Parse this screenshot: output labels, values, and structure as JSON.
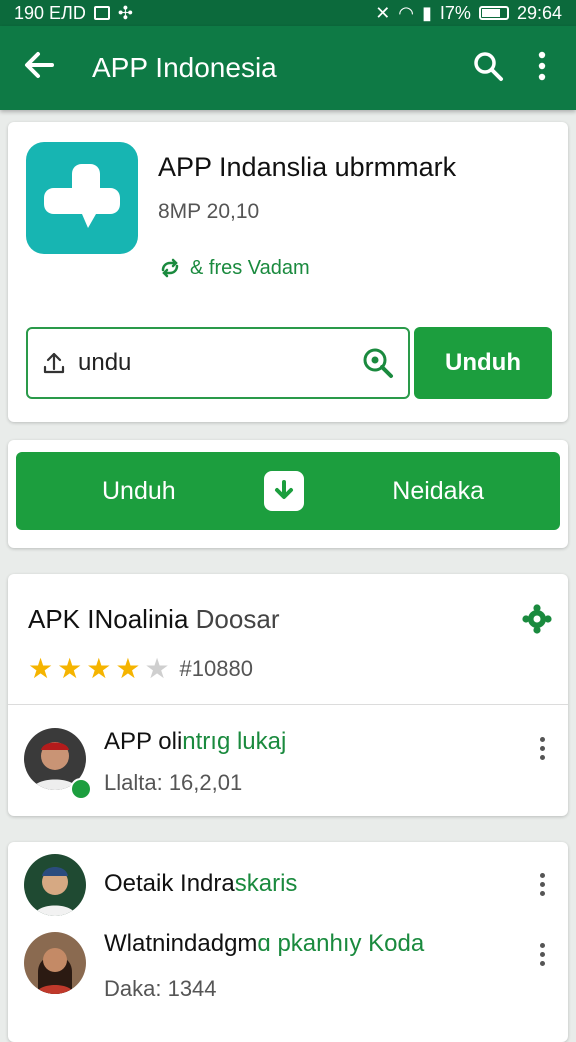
{
  "colors": {
    "primary_dark": "#0c6a3c",
    "primary": "#0e7a45",
    "accent": "#1c9e3e",
    "app_icon": "#17b5b2",
    "star": "#f5b400"
  },
  "status_bar": {
    "left_time": "190 ЕЛD",
    "right_info": "I7%",
    "right_time": "29:64"
  },
  "app_bar": {
    "title": "APP Indonesia",
    "icons": [
      "back-arrow-icon",
      "search-icon",
      "more-vert-icon"
    ]
  },
  "app_card": {
    "name": "APP Indanslia ubrmmark",
    "meta": "8MP 20,10",
    "tag": "& fres Vadam",
    "search_value": "undu",
    "download_button": "Unduh"
  },
  "action_bar": {
    "left_label": "Unduh",
    "right_label": "Neidaka"
  },
  "rating_card": {
    "title_main": "APK INoalinia",
    "title_sub": "Doosar",
    "stars_filled": 4,
    "stars_total": 5,
    "rating_count": "#10880",
    "review": {
      "name_main": "APP oli",
      "name_green": "ntrıg lukaj",
      "date": "Llalta: 16,2,01"
    }
  },
  "list_card": {
    "items": [
      {
        "title_main": "Oetaik Indra",
        "title_green": "skaris",
        "subtitle": ""
      },
      {
        "title_main": "Wlatnindadgm",
        "title_green": "ɑ pkanhıy Koda",
        "subtitle": "Daka: 1344"
      }
    ]
  }
}
